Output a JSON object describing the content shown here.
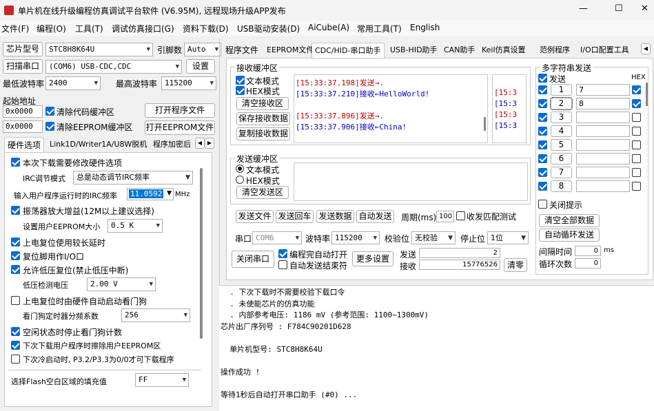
{
  "window": {
    "title": "单片机在线升级编程仿真调试平台软件 (V6.95M), 远程现场升级APP发布",
    "minimize": "—",
    "maximize": "☐",
    "close": "✕"
  },
  "menu": [
    "文件(F)",
    "编程(O)",
    "工具(T)",
    "调试仿真接口(G)",
    "资料下载(D)",
    "USB驱动安装(D)",
    "AiCube(A)",
    "常用工具(T)",
    "English"
  ],
  "left": {
    "chip_btn": "芯片型号",
    "chip_value": "STC8H8K64U",
    "rc_label": "引脚数",
    "rc_value": "Auto",
    "scan_btn": "扫描串口",
    "port_value": "(COM6) USB-CDC,CDC",
    "settings_btn": "设置",
    "min_baud_label": "最低波特率",
    "min_baud": "2400",
    "max_baud_label": "最高波特率",
    "max_baud": "115200",
    "start_addr_label": "起始地址",
    "addr1": "0x0000",
    "clear_code": "清除代码缓冲区",
    "open_prog": "打开程序文件",
    "addr2": "0x0000",
    "clear_eeprom": "清除EEPROM缓冲区",
    "open_eeprom": "打开EEPROM文件",
    "tabs": [
      "硬件选项",
      "Link1D/Writer1A/U8W脱机",
      "程序加密后"
    ],
    "opt1": "本次下载需要修改硬件选项",
    "irc_mode_label": "IRC调节模式",
    "irc_mode": "总是动态调节IRC频率",
    "irc_freq_label": "输入用户程序运行时的IRC频率",
    "irc_freq": "11.0592",
    "irc_unit": "MHz",
    "opt_osc": "振荡器放大增益(12M以上建议选择)",
    "eeprom_size_label": "设置用户EEPROM大小",
    "eeprom_size": "0.5 K",
    "opt_por": "上电复位使用较长延时",
    "opt_reset": "复位脚用作I/O口",
    "opt_lvr": "允许低压复位(禁止低压中断)",
    "lvd_label": "低压检测电压",
    "lvd": "2.00 V",
    "opt_wdt": "上电复位时由硬件自动启动看门狗",
    "wdt_label": "看门狗定时器分频系数",
    "wdt": "256",
    "opt_idle": "空闲状态时停止看门狗计数",
    "opt_erase": "下次下载用户程序时擦除用户EEPROM区",
    "opt_cold": "下次冷启动时, P3.2/P3.3为0/0才可下载程序",
    "fill_label": "选择Flash空白区域的填充值",
    "fill": "FF"
  },
  "tabs": [
    "程序文件",
    "EEPROM文件",
    "CDC/HID-串口助手",
    "USB-HID助手",
    "CAN助手",
    "Keil仿真设置",
    "范例程序",
    "I/O口配置工具"
  ],
  "rx": {
    "title": "接收缓冲区",
    "text_mode": "文本模式",
    "hex_mode": "HEX模式",
    "clear": "清空接收区",
    "save": "保存接收数据",
    "copy": "复制接收数据",
    "log": [
      {
        "t": "[15:33:37.198]发送→.",
        "c": "#c00000"
      },
      {
        "t": "[15:33:37.210]接收←HelloWorld!",
        "c": "#0000c0"
      },
      {
        "t": "",
        "c": "#000"
      },
      {
        "t": "[15:33:37.896]发送→.",
        "c": "#c00000"
      },
      {
        "t": "[15:33:37.906]接收←China!",
        "c": "#0000c0"
      }
    ],
    "side": [
      {
        "t": "[15:3",
        "c": "#c00000"
      },
      {
        "t": "[15:3",
        "c": "#0000c0"
      },
      {
        "t": "[15:3",
        "c": "#c00000"
      },
      {
        "t": "[15:3",
        "c": "#0000c0"
      }
    ]
  },
  "tx": {
    "title": "发送缓冲区",
    "text_mode": "文本模式",
    "hex_mode": "HEX模式",
    "clear": "清空发送区",
    "send_file": "发送文件",
    "send_cr": "发送回车",
    "send_data": "发送数据",
    "auto_send": "自动发送",
    "period_label": "周期(ms)",
    "period": "100",
    "match": "收发匹配测试"
  },
  "serial": {
    "port_label": "串口",
    "port": "COM6",
    "baud_label": "波特率",
    "baud": "115200",
    "parity_label": "校验位",
    "parity": "无校验",
    "stop_label": "停止位",
    "stop": "1位",
    "close_btn": "关闭串口",
    "auto_open": "编程完自动打开",
    "auto_stop": "自动发送结束符",
    "more": "更多设置",
    "sent_label": "发送",
    "sent": "2",
    "recv_label": "接收",
    "recv": "15776526",
    "clear_btn": "清零"
  },
  "multi": {
    "title": "多字符串发送",
    "send_label": "发送",
    "hex_label": "HEX",
    "rows": [
      {
        "n": "1",
        "v": "7",
        "c": true,
        "h": true
      },
      {
        "n": "2",
        "v": "8",
        "c": true,
        "h": true
      },
      {
        "n": "3",
        "v": "",
        "c": true,
        "h": false
      },
      {
        "n": "4",
        "v": "",
        "c": true,
        "h": false
      },
      {
        "n": "5",
        "v": "",
        "c": true,
        "h": false
      },
      {
        "n": "6",
        "v": "",
        "c": true,
        "h": false
      },
      {
        "n": "7",
        "v": "",
        "c": true,
        "h": false
      },
      {
        "n": "8",
        "v": "",
        "c": true,
        "h": false
      }
    ],
    "close_hint": "关闭提示",
    "clear_all": "清空全部数据",
    "auto_loop": "自动循环发送",
    "interval_label": "间隔时间",
    "interval": "0",
    "interval_unit": "ms",
    "loop_label": "循环次数",
    "loop": "0"
  },
  "output": [
    "  . 下次下载时不需要校验下载口令",
    "  . 未使能芯片的仿真功能",
    "  . 内部参考电压: 1186 mV (参考范围: 1100~1300mV)",
    "芯片出厂序列号 : F784C90201D628",
    "",
    "  单片机型号: STC8H8K64U",
    "",
    "操作成功 !",
    "",
    "等待1秒后自动打开串口助手 (#0) ..."
  ]
}
